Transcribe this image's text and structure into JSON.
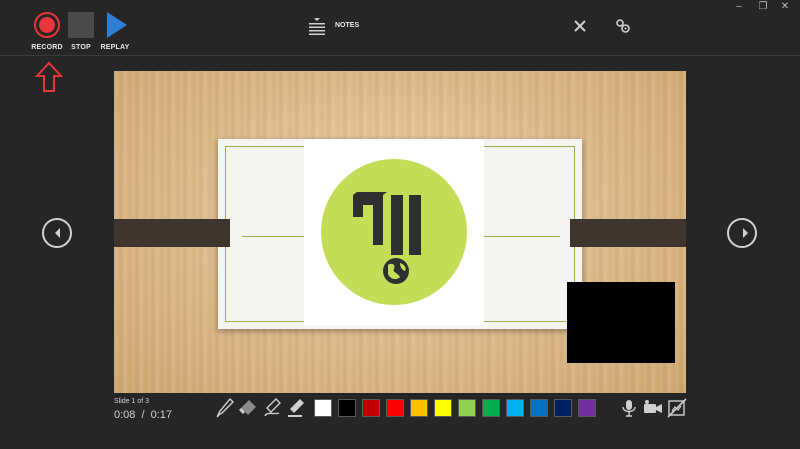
{
  "window": {
    "min_icon": "minimize-icon",
    "restore_icon": "restore-icon",
    "close_icon": "close-icon"
  },
  "toolbar": {
    "record_label": "RECORD",
    "stop_label": "STOP",
    "replay_label": "REPLAY",
    "notes_label": "NOTES",
    "record_color": "#e8363a",
    "replay_color": "#2f7fd6"
  },
  "annotation": {
    "arrow_color": "#e8363a"
  },
  "slide": {
    "counter": "Slide 1 of 3",
    "elapsed": "0:08",
    "separator": "/",
    "total": "0:17"
  },
  "ink": {
    "tools": [
      "pen-icon",
      "eraser-icon",
      "highlighter-icon",
      "marker-icon"
    ],
    "colors": [
      "#ffffff",
      "#000000",
      "#c00000",
      "#ff0000",
      "#ffc000",
      "#ffff00",
      "#92d050",
      "#00b050",
      "#00b0f0",
      "#0070c0",
      "#002060",
      "#7030a0"
    ]
  },
  "media": {
    "mic_icon": "microphone-icon",
    "camera_icon": "camera-icon",
    "preview_icon": "camera-preview-off-icon"
  }
}
